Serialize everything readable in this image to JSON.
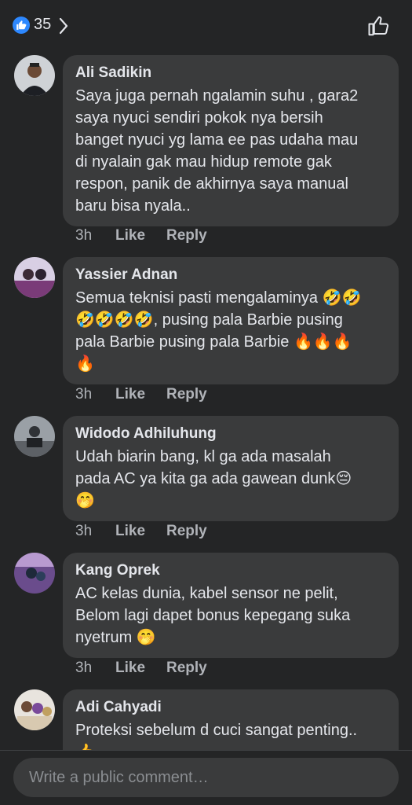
{
  "header": {
    "reaction_count": "35"
  },
  "comments": [
    {
      "author": "Ali Sadikin",
      "text": "Saya juga pernah ngalamin suhu , gara2\nsaya nyuci sendiri pokok nya bersih\nbanget nyuci yg lama ee pas udaha mau\ndi nyalain gak mau hidup remote gak\nrespon, panik de akhirnya saya manual\nbaru bisa nyala..",
      "time": "3h",
      "like": "Like",
      "reply": "Reply"
    },
    {
      "author": "Yassier Adnan",
      "text": "Semua teknisi pasti mengalaminya 🤣🤣\n🤣🤣🤣🤣, pusing pala Barbie pusing\npala Barbie pusing pala Barbie 🔥🔥🔥\n🔥",
      "time": "3h",
      "like": "Like",
      "reply": "Reply"
    },
    {
      "author": "Widodo Adhiluhung",
      "text": "Udah biarin bang, kl ga ada masalah\npada AC ya kita ga ada gawean dunk😔\n🤭",
      "time": "3h",
      "like": "Like",
      "reply": "Reply"
    },
    {
      "author": "Kang Oprek",
      "text": "AC kelas dunia, kabel sensor ne pelit,\nBelom lagi dapet bonus kepegang suka\nnyetrum 🤭",
      "time": "3h",
      "like": "Like",
      "reply": "Reply"
    },
    {
      "author": "Adi Cahyadi",
      "text": "Proteksi sebelum d cuci sangat penting..\n👍",
      "time": "",
      "like": "",
      "reply": ""
    }
  ],
  "composer": {
    "placeholder": "Write a public comment…"
  }
}
